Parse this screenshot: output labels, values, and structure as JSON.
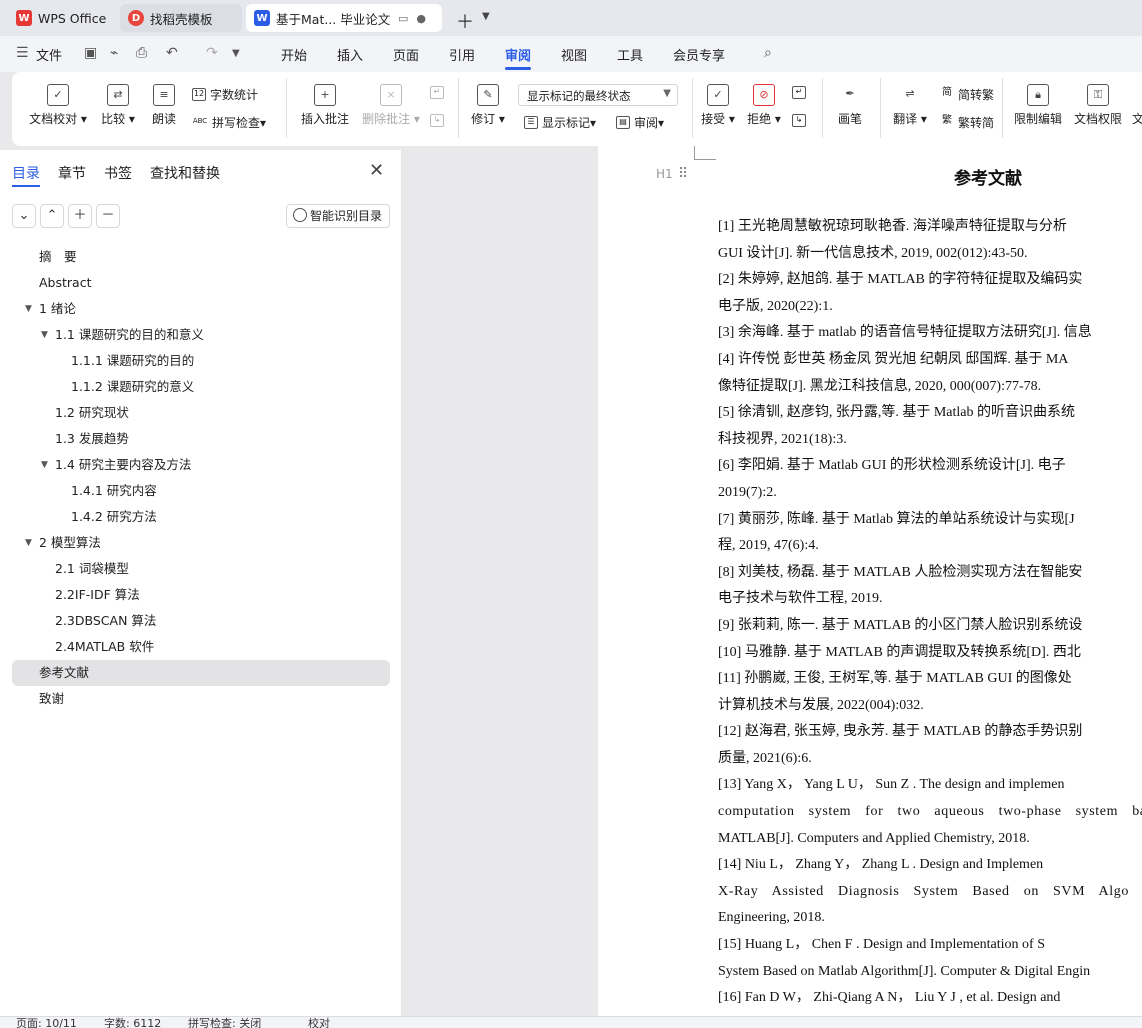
{
  "tabs": [
    {
      "label": "WPS Office",
      "icon": "wps-logo-icon"
    },
    {
      "label": "找稻壳模板",
      "icon": "docer-icon"
    },
    {
      "label": "基于Mat... 毕业论文",
      "icon": "word-doc-icon"
    }
  ],
  "menu": {
    "file_label": "文件",
    "items": [
      "开始",
      "插入",
      "页面",
      "引用",
      "审阅",
      "视图",
      "工具",
      "会员专享"
    ],
    "active": "审阅"
  },
  "ribbon": {
    "doc_check": "文档校对",
    "compare": "比较",
    "read_aloud": "朗读",
    "word_count": "字数统计",
    "spell_check": "拼写检查",
    "insert_comment": "插入批注",
    "delete_comment": "删除批注",
    "revise": "修订",
    "markup_state": "显示标记的最终状态",
    "show_markup": "显示标记",
    "review": "审阅",
    "accept": "接受",
    "reject": "拒绝",
    "pen": "画笔",
    "translate": "翻译",
    "to_traditional": "简转繁",
    "to_simplified": "繁转简",
    "restrict_edit": "限制编辑",
    "doc_permission": "文档权限",
    "cut_label": "文",
    "icon_labels": {
      "abc": "ABC",
      "count": "12",
      "jian": "简",
      "fan": "繁"
    }
  },
  "nav": {
    "tabs": [
      "目录",
      "章节",
      "书签",
      "查找和替换"
    ],
    "active_tab": "目录",
    "smart_toc": "智能识别目录",
    "toc": [
      {
        "label": "摘　要",
        "level": 1,
        "expand": ""
      },
      {
        "label": "Abstract",
        "level": 1,
        "expand": ""
      },
      {
        "label": "1 绪论",
        "level": 1,
        "expand": "▼"
      },
      {
        "label": "1.1 课题研究的目的和意义",
        "level": 2,
        "expand": "▼"
      },
      {
        "label": "1.1.1 课题研究的目的",
        "level": 3,
        "expand": ""
      },
      {
        "label": "1.1.2 课题研究的意义",
        "level": 3,
        "expand": ""
      },
      {
        "label": "1.2 研究现状",
        "level": 2,
        "expand": ""
      },
      {
        "label": "1.3 发展趋势",
        "level": 2,
        "expand": ""
      },
      {
        "label": "1.4 研究主要内容及方法",
        "level": 2,
        "expand": "▼"
      },
      {
        "label": "1.4.1 研究内容",
        "level": 3,
        "expand": ""
      },
      {
        "label": "1.4.2 研究方法",
        "level": 3,
        "expand": ""
      },
      {
        "label": "2 模型算法",
        "level": 1,
        "expand": "▼"
      },
      {
        "label": "2.1 词袋模型",
        "level": 2,
        "expand": ""
      },
      {
        "label": "2.2IF-IDF 算法",
        "level": 2,
        "expand": ""
      },
      {
        "label": "2.3DBSCAN 算法",
        "level": 2,
        "expand": ""
      },
      {
        "label": "2.4MATLAB 软件",
        "level": 2,
        "expand": ""
      },
      {
        "label": "参考文献",
        "level": 1,
        "expand": "",
        "selected": true
      },
      {
        "label": "致谢",
        "level": 1,
        "expand": ""
      }
    ]
  },
  "document": {
    "heading_marker": "H1",
    "title": "参考文献",
    "lines": [
      "[1]  王光艳周慧敏祝琼珂耿艳香. 海洋噪声特征提取与分析",
      "GUI 设计[J]. 新一代信息技术, 2019, 002(012):43-50.",
      "[2]  朱婷婷, 赵旭鸽. 基于 MATLAB 的字符特征提取及编码实",
      "电子版, 2020(22):1.",
      "[3]  余海峰. 基于 matlab 的语音信号特征提取方法研究[J]. 信息",
      "[4]  许传悦  彭世英  杨金凤  贺光旭  纪朝凤  邸国辉. 基于 MA",
      "像特征提取[J]. 黑龙江科技信息, 2020, 000(007):77-78.",
      "[5]  徐清钏, 赵彦钧, 张丹露,等. 基于 Matlab 的听音识曲系统",
      "科技视界, 2021(18):3.",
      "[6]  李阳娟. 基于 Matlab GUI 的形状检测系统设计[J]. 电子",
      "2019(7):2.",
      "[7]  黄丽莎, 陈峰. 基于 Matlab 算法的单站系统设计与实现[J",
      "程, 2019, 47(6):4.",
      "[8]  刘美枝, 杨磊. 基于 MATLAB 人脸检测实现方法在智能安",
      "电子技术与软件工程, 2019.",
      "[9]  张莉莉, 陈一. 基于 MATLAB 的小区门禁人脸识别系统设",
      "[10]  马雅静. 基于 MATLAB 的声调提取及转换系统[D]. 西北",
      "[11]  孙鹏崴, 王俊, 王树军,等. 基于 MATLAB GUI 的图像处",
      "计算机技术与发展, 2022(004):032.",
      "[12]  赵海君, 张玉婷, 曳永芳. 基于 MATLAB 的静态手势识别",
      "质量, 2021(6):6.",
      "[13]   Yang X， Yang L U， Sun Z . The design and implemen",
      "computation  system  for  two  aqueous  two-phase  system  ba",
      "MATLAB[J]. Computers and Applied Chemistry, 2018.",
      "[14]   Niu L， Zhang Y， Zhang L . Design and Implemen",
      "X-Ray  Assisted  Diagnosis  System  Based  on  SVM  Algo",
      "Engineering, 2018.",
      "[15]   Huang L， Chen F . Design and Implementation of S",
      "System Based on Matlab Algorithm[J]. Computer & Digital Engin",
      "[16]   Fan D W， Zhi-Qiang A N， Liu Y J , et al. Design and"
    ]
  },
  "status": {
    "page": "页面: 10/11",
    "words": "字数: 6112",
    "spell": "拼写检查: 关闭",
    "proof": "校对"
  },
  "colors": {
    "accent": "#2b5ce6",
    "wps_red": "#e53935",
    "selection": "#e3e3e6"
  }
}
